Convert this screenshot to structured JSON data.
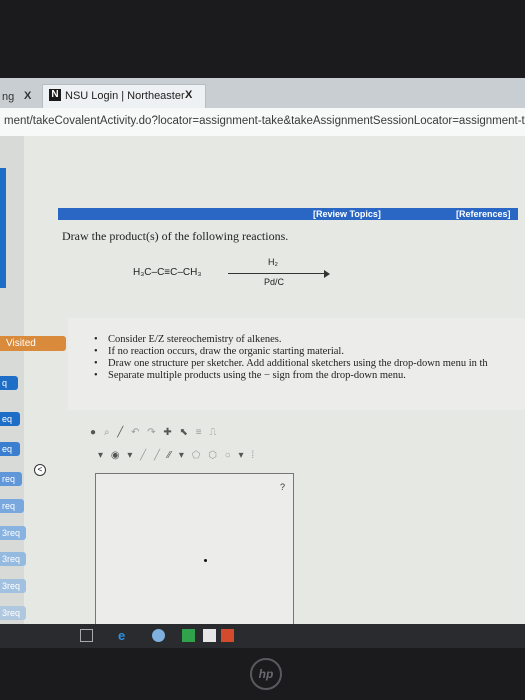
{
  "browser": {
    "tabs": [
      {
        "label": "ng",
        "close": "X"
      },
      {
        "label": "NSU Login | Northeaster",
        "close": "X"
      }
    ],
    "url": "ment/takeCovalentActivity.do?locator=assignment-take&takeAssignmentSessionLocator=assignment-tal"
  },
  "header": {
    "review_topics": "[Review Topics]",
    "references": "[References]"
  },
  "question": {
    "instruction": "Draw the product(s) of the following reactions.",
    "reactant": "H₃C–C≡C–CH₃",
    "reagent_top": "H₂",
    "reagent_bottom": "Pd/C"
  },
  "tips": [
    "Consider E/Z stereochemistry of alkenes.",
    "If no reaction occurs, draw the organic starting material.",
    "Draw one structure per sketcher. Add additional sketchers using the drop-down menu in th",
    "Separate multiple products using the − sign from the drop-down menu."
  ],
  "sidebar": {
    "visited": "Visited",
    "items": [
      "q",
      "eq",
      "eq",
      "req",
      "req",
      "3req",
      "3req",
      "3req",
      "3req"
    ]
  },
  "sketcher": {
    "help": "?",
    "collapse": "<"
  },
  "bezel_logo": "hp"
}
